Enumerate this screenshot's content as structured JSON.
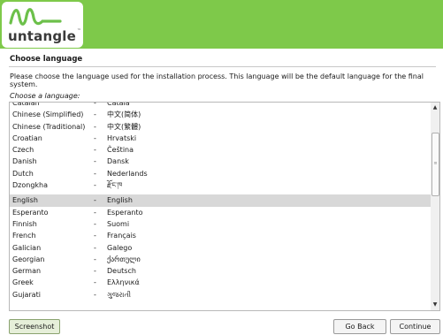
{
  "header": {
    "logo_text": "untangle",
    "logo_tm": "™"
  },
  "page": {
    "title": "Choose language",
    "description": "Please choose the language used for the installation process. This language will be the default language for the final system.",
    "prompt": "Choose a language:"
  },
  "languages": [
    {
      "name": "Catalan",
      "native": "Català"
    },
    {
      "name": "Chinese (Simplified)",
      "native": "中文(简体)"
    },
    {
      "name": "Chinese (Traditional)",
      "native": "中文(繁體)"
    },
    {
      "name": "Croatian",
      "native": "Hrvatski"
    },
    {
      "name": "Czech",
      "native": "Čeština"
    },
    {
      "name": "Danish",
      "native": "Dansk"
    },
    {
      "name": "Dutch",
      "native": "Nederlands"
    },
    {
      "name": "Dzongkha",
      "native": "རྫོང་ཁ"
    },
    {
      "name": "English",
      "native": "English",
      "selected": true
    },
    {
      "name": "Esperanto",
      "native": "Esperanto"
    },
    {
      "name": "Finnish",
      "native": "Suomi"
    },
    {
      "name": "French",
      "native": "Français"
    },
    {
      "name": "Galician",
      "native": "Galego"
    },
    {
      "name": "Georgian",
      "native": "ქართული"
    },
    {
      "name": "German",
      "native": "Deutsch"
    },
    {
      "name": "Greek",
      "native": "Ελληνικά"
    },
    {
      "name": "Gujarati",
      "native": "ગુજરાતી"
    }
  ],
  "separator": "-",
  "buttons": {
    "screenshot": "Screenshot",
    "go_back": "Go Back",
    "continue": "Continue"
  },
  "colors": {
    "header_green": "#7ec94a",
    "logo_green": "#6cc04a",
    "selected_row": "#d8d8d8"
  }
}
